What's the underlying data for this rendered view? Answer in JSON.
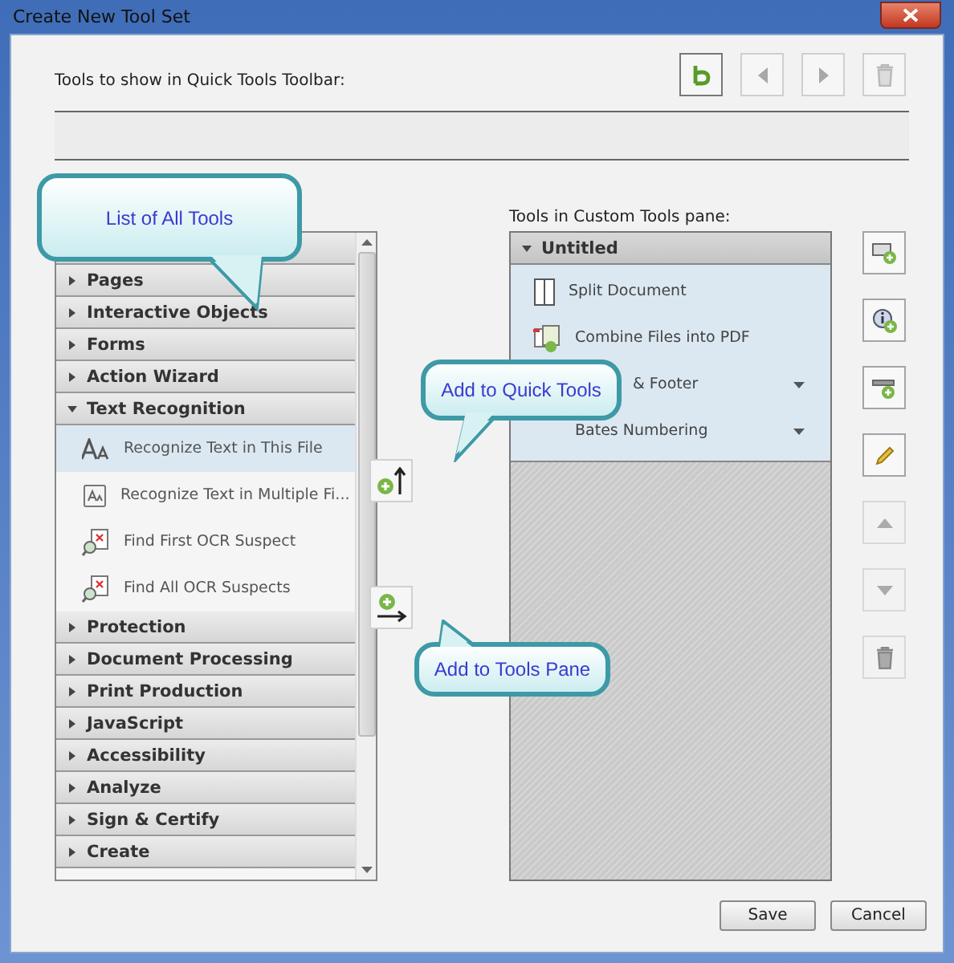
{
  "window": {
    "title": "Create New Tool Set"
  },
  "quick_tools": {
    "label": "Tools to show in Quick Tools Toolbar:",
    "toolbar": [
      {
        "kind": "tool",
        "disabled": false
      },
      {
        "kind": "left",
        "disabled": true
      },
      {
        "kind": "right",
        "disabled": true
      },
      {
        "kind": "delete",
        "disabled": true
      }
    ]
  },
  "all_tools": {
    "groups": [
      {
        "label": "Pages",
        "expanded": false
      },
      {
        "label": "Interactive Objects",
        "expanded": false
      },
      {
        "label": "Forms",
        "expanded": false
      },
      {
        "label": "Action Wizard",
        "expanded": false
      },
      {
        "label": "Text Recognition",
        "expanded": true,
        "children": [
          {
            "label": "Recognize Text in This File",
            "selected": true
          },
          {
            "label": "Recognize Text in Multiple Fi...",
            "selected": false
          },
          {
            "label": "Find First OCR Suspect",
            "selected": false
          },
          {
            "label": "Find All OCR Suspects",
            "selected": false
          }
        ]
      },
      {
        "label": "Protection",
        "expanded": false
      },
      {
        "label": "Document Processing",
        "expanded": false
      },
      {
        "label": "Print Production",
        "expanded": false
      },
      {
        "label": "JavaScript",
        "expanded": false
      },
      {
        "label": "Accessibility",
        "expanded": false
      },
      {
        "label": "Analyze",
        "expanded": false
      },
      {
        "label": "Sign & Certify",
        "expanded": false
      },
      {
        "label": "Create",
        "expanded": false
      }
    ]
  },
  "custom_pane": {
    "label": "Tools in Custom Tools pane:",
    "panel": {
      "label": "Untitled",
      "expanded": true,
      "children": [
        {
          "label": "Split Document",
          "has_menu": false
        },
        {
          "label": "Combine Files into PDF",
          "has_menu": false
        },
        {
          "label": "& Footer",
          "has_menu": true
        },
        {
          "label": "Bates Numbering",
          "has_menu": true
        }
      ]
    }
  },
  "side_buttons": [
    {
      "kind": "add-panel",
      "disabled": false
    },
    {
      "kind": "add-info",
      "disabled": false
    },
    {
      "kind": "add-divider",
      "disabled": false
    },
    {
      "kind": "rename",
      "disabled": false
    },
    {
      "kind": "up",
      "disabled": true
    },
    {
      "kind": "down",
      "disabled": true
    },
    {
      "kind": "delete",
      "disabled": true
    }
  ],
  "callouts": [
    {
      "text": "List of All Tools"
    },
    {
      "text": "Add to Quick Tools"
    },
    {
      "text": "Add to Tools Pane"
    }
  ],
  "buttons": [
    "Save",
    "Cancel"
  ]
}
